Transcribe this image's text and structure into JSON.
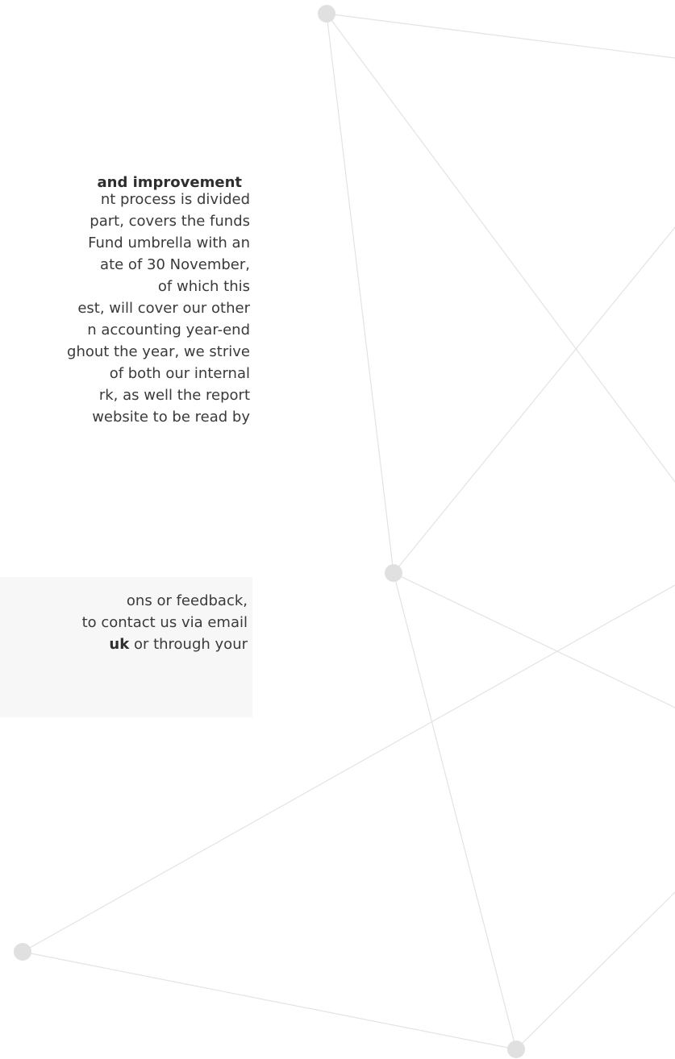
{
  "section": {
    "heading": "and improvement",
    "paragraph_lines": [
      "nt process is divided",
      "part, covers the funds",
      "Fund umbrella with an",
      "ate of 30 November,",
      "of which this",
      "est, will cover our other",
      "n accounting year-end",
      "ghout the year, we strive",
      "of both our internal",
      "rk, as well the report",
      "website to be read by"
    ]
  },
  "callout": {
    "line1": "ons or feedback,",
    "line2": "to contact us via email",
    "line3_bold": "uk",
    "line3_rest": " or through your"
  },
  "colors": {
    "network_line": "#e3e3e3",
    "network_node": "#e0e0e0",
    "callout_background": "#f7f7f7",
    "text": "#3a3a3a"
  }
}
